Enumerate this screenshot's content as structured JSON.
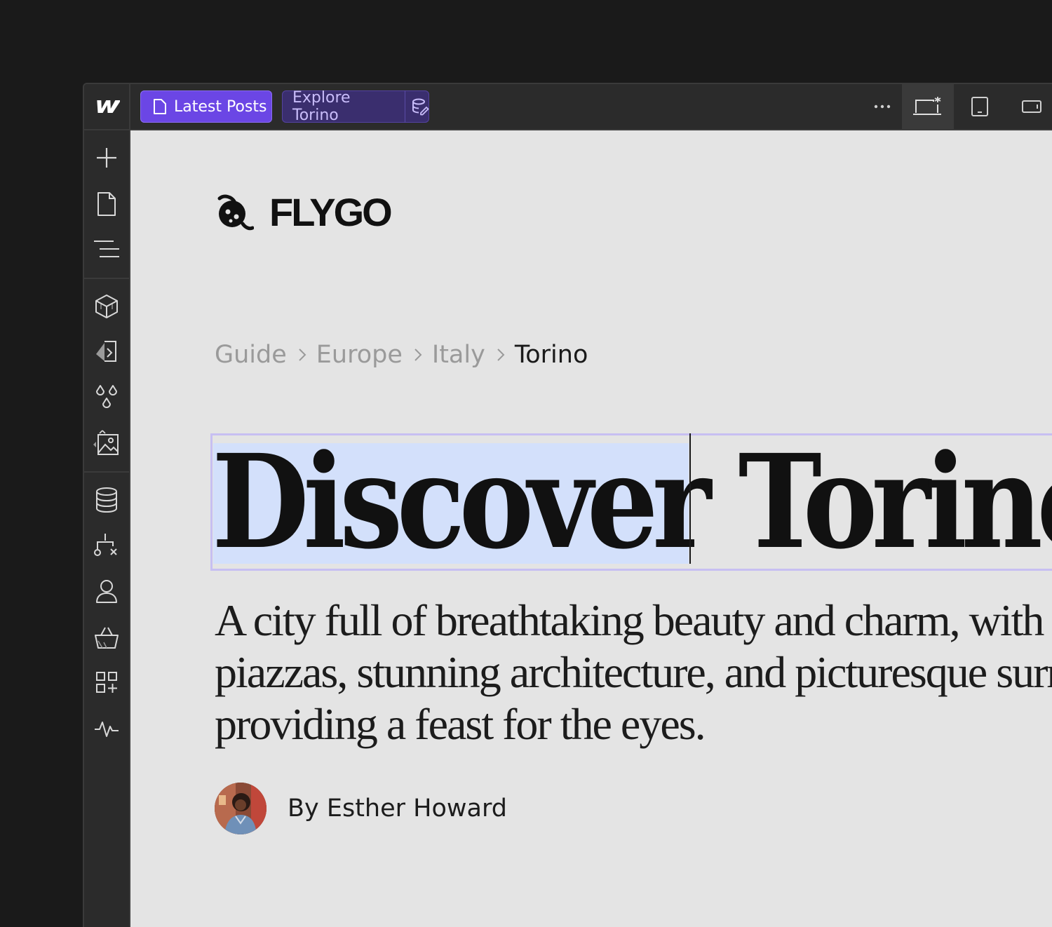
{
  "toolbar": {
    "page_chip": "Latest Posts",
    "collection_chip": "Explore Torino"
  },
  "sidebar": {
    "items": [
      {
        "icon": "plus-icon"
      },
      {
        "icon": "page-icon"
      },
      {
        "icon": "navigator-icon"
      },
      {
        "icon": "components-icon"
      },
      {
        "icon": "styles-icon"
      },
      {
        "icon": "variables-icon"
      },
      {
        "icon": "assets-icon"
      },
      {
        "icon": "cms-icon"
      },
      {
        "icon": "logic-icon"
      },
      {
        "icon": "users-icon"
      },
      {
        "icon": "ecommerce-icon"
      },
      {
        "icon": "apps-icon"
      },
      {
        "icon": "audit-icon"
      }
    ]
  },
  "site": {
    "brand": "FLYGO",
    "breadcrumbs": [
      "Guide",
      "Europe",
      "Italy"
    ],
    "breadcrumb_current": "Torino",
    "heading": "Discover Torino",
    "lede": "A city full of breathtaking beauty and charm, with its grand piazzas, stunning architecture, and picturesque surrounding hills providing a feast for the eyes.",
    "author": "By Esther Howard"
  },
  "colors": {
    "accent": "#6b46e5",
    "selection": "#d3e0fb",
    "selection_border": "#c7bff2",
    "canvas": "#e4e4e4"
  }
}
